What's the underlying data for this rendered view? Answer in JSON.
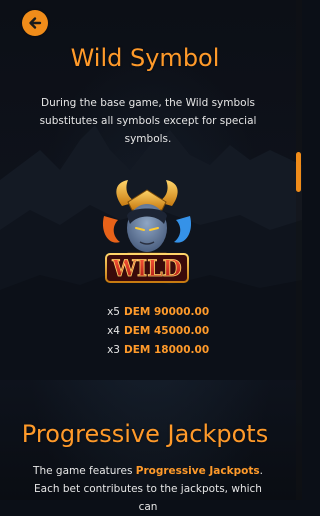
{
  "back_button": {
    "icon": "arrow-left-icon",
    "color": "#f08c1a"
  },
  "wild_section": {
    "title": "Wild Symbol",
    "description": "During the base game, the Wild symbols substitutes all symbols except for special symbols.",
    "symbol_text": "WILD",
    "payouts": [
      {
        "multiplier": "x5",
        "value": "DEM 90000.00"
      },
      {
        "multiplier": "x4",
        "value": "DEM 45000.00"
      },
      {
        "multiplier": "x3",
        "value": "DEM 18000.00"
      }
    ]
  },
  "jackpot_section": {
    "title": "Progressive Jackpots",
    "desc_before": "The game features ",
    "desc_highlight": "Progressive Jackpots",
    "desc_after": ". Each bet contributes to the jackpots, which can"
  },
  "colors": {
    "accent": "#ff9a2a",
    "background": "#0b0f17"
  }
}
